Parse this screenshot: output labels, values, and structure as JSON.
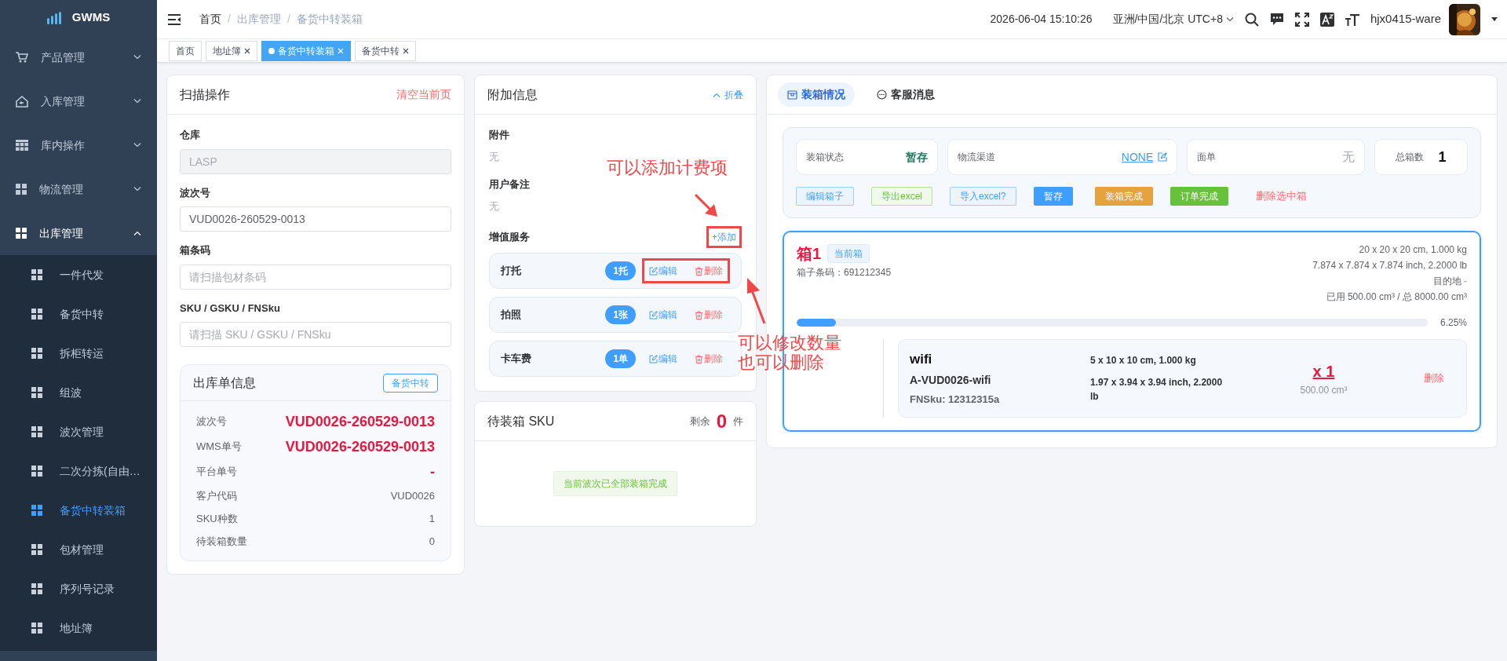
{
  "sidebar": {
    "logo": "GWMS",
    "items": [
      {
        "label": "产品管理",
        "kind": "cart",
        "expanded": false
      },
      {
        "label": "入库管理",
        "kind": "home",
        "expanded": false
      },
      {
        "label": "库内操作",
        "kind": "table",
        "expanded": false
      },
      {
        "label": "物流管理",
        "kind": "grid",
        "expanded": false
      },
      {
        "label": "出库管理",
        "kind": "grid",
        "expanded": true,
        "children": [
          {
            "label": "一件代发",
            "selected": false
          },
          {
            "label": "备货中转",
            "selected": false
          },
          {
            "label": "拆柜转运",
            "selected": false
          },
          {
            "label": "组波",
            "selected": false
          },
          {
            "label": "波次管理",
            "selected": false
          },
          {
            "label": "二次分拣(自由…",
            "selected": false
          },
          {
            "label": "备货中转装箱",
            "selected": true
          },
          {
            "label": "包材管理",
            "selected": false
          },
          {
            "label": "序列号记录",
            "selected": false
          },
          {
            "label": "地址簿",
            "selected": false
          }
        ]
      }
    ]
  },
  "header": {
    "breadcrumb": [
      {
        "label": "首页"
      },
      {
        "separator": "/",
        "label": "出库管理"
      },
      {
        "separator": "/",
        "label": "备货中转装箱"
      }
    ],
    "datetime": "2026-06-04 15:10:26",
    "timezone": "亚洲/中国/北京 UTC+8",
    "user": "hjx0415-ware"
  },
  "tabs": [
    {
      "label": "首页",
      "selected": false,
      "closable": false
    },
    {
      "label": "地址簿",
      "selected": false,
      "closable": true
    },
    {
      "label": "备货中转装箱",
      "selected": true,
      "closable": true
    },
    {
      "label": "备货中转",
      "selected": false,
      "closable": true
    }
  ],
  "scan": {
    "title": "扫描操作",
    "clear": "清空当前页",
    "fields": [
      {
        "label": "仓库",
        "value": "LASP",
        "disabled": true
      },
      {
        "label": "波次号",
        "value": "VUD0026-260529-0013",
        "disabled": false
      },
      {
        "label": "箱条码",
        "placeholder": "请扫描包材条码",
        "disabled": false
      },
      {
        "label": "SKU / GSKU / FNSku",
        "placeholder": "请扫描 SKU / GSKU / FNSku",
        "disabled": false
      }
    ],
    "order": {
      "title": "出库单信息",
      "tag": "备货中转",
      "rows": [
        {
          "label": "波次号",
          "value": "VUD0026-260529-0013",
          "emphasis": true
        },
        {
          "label": "WMS单号",
          "value": "VUD0026-260529-0013",
          "emphasis": true
        },
        {
          "label": "平台单号",
          "value": "-",
          "emphasis": true
        },
        {
          "label": "客户代码",
          "value": "VUD0026",
          "emphasis": false
        },
        {
          "label": "SKU种数",
          "value": "1",
          "emphasis": false
        },
        {
          "label": "待装箱数量",
          "value": "0",
          "emphasis": false
        }
      ]
    }
  },
  "extra": {
    "title": "附加信息",
    "collapse": "折叠",
    "sections": [
      {
        "label": "附件",
        "value": "无"
      },
      {
        "label": "用户备注",
        "value": "无"
      }
    ],
    "services_label": "增值服务",
    "add": {
      "label": "+添加",
      "highlighted": true
    },
    "services": [
      {
        "name": "打托",
        "qty": "1托",
        "edit": "编辑",
        "delete": "删除",
        "highlighted": true
      },
      {
        "name": "拍照",
        "qty": "1张",
        "edit": "编辑",
        "delete": "删除",
        "highlighted": false
      },
      {
        "name": "卡车费",
        "qty": "1单",
        "edit": "编辑",
        "delete": "删除",
        "highlighted": false
      }
    ]
  },
  "pending": {
    "title": "待装箱 SKU",
    "remain_label": "剩余",
    "remain": "0",
    "unit": "件",
    "empty": "当前波次已全部装箱完成"
  },
  "packing": {
    "tabs": [
      {
        "label": "装箱情况",
        "kind": "box",
        "selected": true
      },
      {
        "label": "客服消息",
        "kind": "chat",
        "selected": false
      }
    ],
    "stats": [
      {
        "label": "装箱状态",
        "value": "暂存",
        "kind": "status"
      },
      {
        "label": "物流渠道",
        "value": "NONE",
        "kind": "link"
      },
      {
        "label": "面单",
        "value": "无",
        "kind": "muted"
      },
      {
        "label": "总箱数",
        "value": "1",
        "kind": "count"
      }
    ],
    "actions": [
      {
        "label": "编辑箱子",
        "kind": "primary-outline"
      },
      {
        "label": "导出excel",
        "kind": "success-outline"
      },
      {
        "label": "导入excel?",
        "kind": "primary-outline"
      },
      {
        "label": "暂存",
        "kind": "primary"
      },
      {
        "label": "装箱完成",
        "kind": "warning"
      },
      {
        "label": "订单完成",
        "kind": "success"
      },
      {
        "label": "删除选中箱",
        "kind": "danger-text"
      }
    ],
    "boxes": [
      {
        "title": "箱1",
        "tag": "当前箱",
        "selected": true,
        "barcode": "箱子条码：691212345",
        "specs": [
          "20 x 20 x 20 cm, 1.000 kg",
          "7.874 x 7.874 x 7.874 inch, 2.2000 lb"
        ],
        "destination_label": "目的地",
        "destination": "-",
        "usage": "已用 500.00 cm³ / 总 8000.00 cm³",
        "level": 0.0625,
        "percent": "6.25%",
        "items": [
          {
            "name": "wifi",
            "sku": "A-VUD0026-wifi",
            "fnsku": "FNSku: 12312315a",
            "dims": "5 x 10 x 10 cm, 1.000 kg",
            "dims_inch": "1.97 x 3.94 x 3.94 inch, 2.2000 lb",
            "qty": "x 1",
            "volume": "500.00 cm³",
            "delete": "删除"
          }
        ]
      }
    ]
  },
  "annotations": [
    {
      "lines": [
        "可以添加计费项"
      ]
    },
    {
      "lines": [
        "可以修改数量",
        "也可以删除"
      ]
    }
  ]
}
